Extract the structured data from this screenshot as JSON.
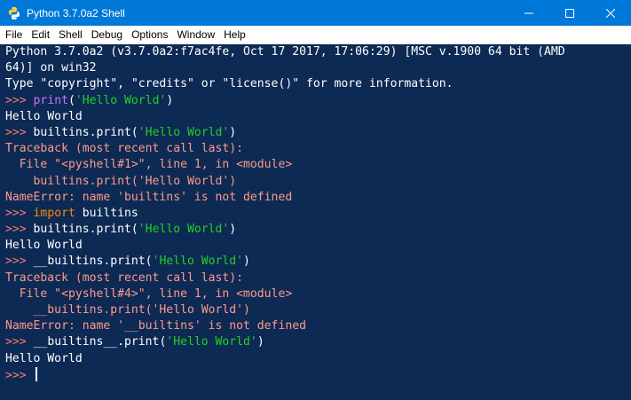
{
  "window": {
    "title": "Python 3.7.0a2 Shell",
    "accent": "#0078d7"
  },
  "menu": {
    "items": [
      "File",
      "Edit",
      "Shell",
      "Debug",
      "Options",
      "Window",
      "Help"
    ]
  },
  "colors": {
    "background": "#0d2a55",
    "prompt": "#ff7a6e",
    "keyword": "#ff8a00",
    "builtin": "#d070ff",
    "string": "#22d022",
    "error": "#ff9a8a",
    "text": "#ffffff"
  },
  "shell": {
    "lines": [
      [
        {
          "t": "Python 3.7.0a2 (v3.7.0a2:f7ac4fe, Oct 17 2017, 17:06:29) [MSC v.1900 64 bit (AMD",
          "c": "default"
        }
      ],
      [
        {
          "t": "64)] on win32",
          "c": "default"
        }
      ],
      [
        {
          "t": "Type \"copyright\", \"credits\" or \"license()\" for more information.",
          "c": "default"
        }
      ],
      [
        {
          "t": ">>> ",
          "c": "prompt"
        },
        {
          "t": "print",
          "c": "builtin"
        },
        {
          "t": "(",
          "c": "default"
        },
        {
          "t": "'Hello World'",
          "c": "string"
        },
        {
          "t": ")",
          "c": "default"
        }
      ],
      [
        {
          "t": "Hello World",
          "c": "output"
        }
      ],
      [
        {
          "t": ">>> ",
          "c": "prompt"
        },
        {
          "t": "builtins.print(",
          "c": "default"
        },
        {
          "t": "'Hello World'",
          "c": "string"
        },
        {
          "t": ")",
          "c": "default"
        }
      ],
      [
        {
          "t": "Traceback (most recent call last):",
          "c": "error"
        }
      ],
      [
        {
          "t": "  File \"<pyshell#1>\", line 1, in <module>",
          "c": "error"
        }
      ],
      [
        {
          "t": "    builtins.print('Hello World')",
          "c": "error"
        }
      ],
      [
        {
          "t": "NameError: name 'builtins' is not defined",
          "c": "error"
        }
      ],
      [
        {
          "t": ">>> ",
          "c": "prompt"
        },
        {
          "t": "import",
          "c": "keyword"
        },
        {
          "t": " builtins",
          "c": "default"
        }
      ],
      [
        {
          "t": ">>> ",
          "c": "prompt"
        },
        {
          "t": "builtins.print(",
          "c": "default"
        },
        {
          "t": "'Hello World'",
          "c": "string"
        },
        {
          "t": ")",
          "c": "default"
        }
      ],
      [
        {
          "t": "Hello World",
          "c": "output"
        }
      ],
      [
        {
          "t": ">>> ",
          "c": "prompt"
        },
        {
          "t": "__builtins.print(",
          "c": "default"
        },
        {
          "t": "'Hello World'",
          "c": "string"
        },
        {
          "t": ")",
          "c": "default"
        }
      ],
      [
        {
          "t": "Traceback (most recent call last):",
          "c": "error"
        }
      ],
      [
        {
          "t": "  File \"<pyshell#4>\", line 1, in <module>",
          "c": "error"
        }
      ],
      [
        {
          "t": "    __builtins.print('Hello World')",
          "c": "error"
        }
      ],
      [
        {
          "t": "NameError: name '__builtins' is not defined",
          "c": "error"
        }
      ],
      [
        {
          "t": ">>> ",
          "c": "prompt"
        },
        {
          "t": "__builtins__.print(",
          "c": "default"
        },
        {
          "t": "'Hello World'",
          "c": "string"
        },
        {
          "t": ")",
          "c": "default"
        }
      ],
      [
        {
          "t": "Hello World",
          "c": "output"
        }
      ],
      [
        {
          "t": ">>> ",
          "c": "prompt"
        }
      ]
    ]
  }
}
